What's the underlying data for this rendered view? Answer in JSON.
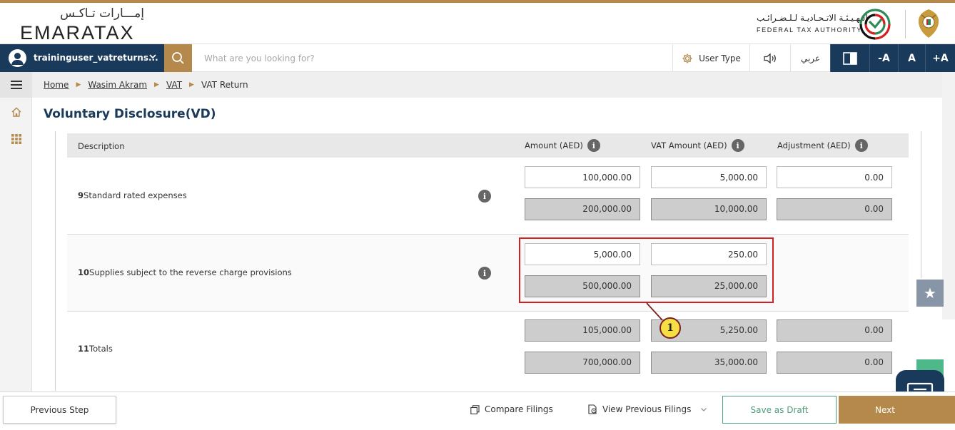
{
  "header": {
    "logo_ar": "إمـــارات تـاكـس",
    "logo_en": "EMARATAX",
    "authority_ar": "الـهـيـئـة الاتـحـاديـة لـلـضـرائـب",
    "authority_en": "FEDERAL TAX AUTHORITY"
  },
  "toolbar": {
    "username": "traininguser_vatreturns...",
    "search_placeholder": "What are you looking for?",
    "user_type_label": "User Type",
    "language_label": "عربي",
    "font_decrease": "-A",
    "font_normal": "A",
    "font_increase": "+A"
  },
  "breadcrumb": [
    "Home",
    "Wasim Akram",
    "VAT",
    "VAT Return"
  ],
  "page_title": "Voluntary Disclosure(VD)",
  "table": {
    "headers": {
      "description": "Description",
      "amount": "Amount (AED)",
      "vat_amount": "VAT Amount (AED)",
      "adjustment": "Adjustment (AED)"
    },
    "rows": [
      {
        "number": "9",
        "label": "Standard rated expenses",
        "amount_input": "100,000.00",
        "vat_input": "5,000.00",
        "adjustment_input": "0.00",
        "amount_total": "200,000.00",
        "vat_total": "10,000.00",
        "adjustment_total": "0.00"
      },
      {
        "number": "10",
        "label": "Supplies subject to the reverse charge provisions",
        "amount_input": "5,000.00",
        "vat_input": "250.00",
        "amount_total": "500,000.00",
        "vat_total": "25,000.00"
      },
      {
        "number": "11",
        "label": "Totals",
        "amount_input": "105,000.00",
        "vat_input": "5,250.00",
        "adjustment_input": "0.00",
        "amount_total": "700,000.00",
        "vat_total": "35,000.00",
        "adjustment_total": "0.00"
      }
    ]
  },
  "callout_number": "1",
  "footer": {
    "previous_step": "Previous Step",
    "compare_filings": "Compare Filings",
    "view_previous_filings": "View Previous Filings",
    "save_as_draft": "Save as Draft",
    "next": "Next"
  },
  "colors": {
    "navy": "#1a3a5c",
    "gold": "#b4894b",
    "green": "#4f9e7a",
    "highlight_red": "#d42020",
    "callout_yellow": "#f6df45"
  }
}
